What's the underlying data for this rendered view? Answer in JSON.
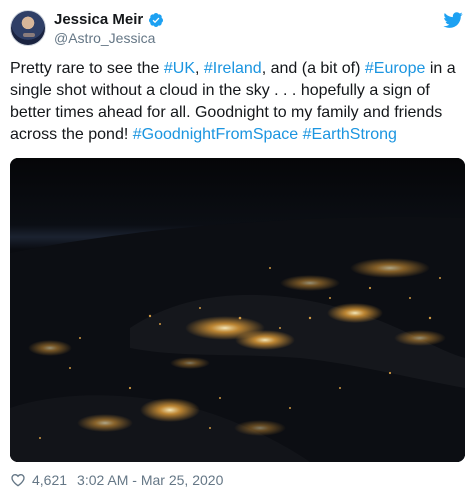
{
  "author": {
    "display_name": "Jessica Meir",
    "handle": "@Astro_Jessica"
  },
  "tweet": {
    "segments": [
      {
        "text": "Pretty rare to see the ",
        "hashtag": false
      },
      {
        "text": "#UK",
        "hashtag": true
      },
      {
        "text": ", ",
        "hashtag": false
      },
      {
        "text": "#Ireland",
        "hashtag": true
      },
      {
        "text": ", and (a bit of) ",
        "hashtag": false
      },
      {
        "text": "#Europe",
        "hashtag": true
      },
      {
        "text": " in a single shot without a cloud in the sky . . . hopefully a sign of better times ahead for all.  Goodnight to my family and friends across the pond!  ",
        "hashtag": false
      },
      {
        "text": "#GoodnightFromSpace",
        "hashtag": true
      },
      {
        "text": " ",
        "hashtag": false
      },
      {
        "text": "#EarthStrong",
        "hashtag": true
      }
    ]
  },
  "footer": {
    "likes": "4,621",
    "timestamp": "3:02 AM - Mar 25, 2020"
  },
  "colors": {
    "link": "#1b95e0",
    "verified": "#1da1f2",
    "muted": "#657786",
    "city_lights": "#f2a93b"
  },
  "icons": [
    "verified-badge-icon",
    "twitter-bird-icon",
    "heart-icon"
  ]
}
